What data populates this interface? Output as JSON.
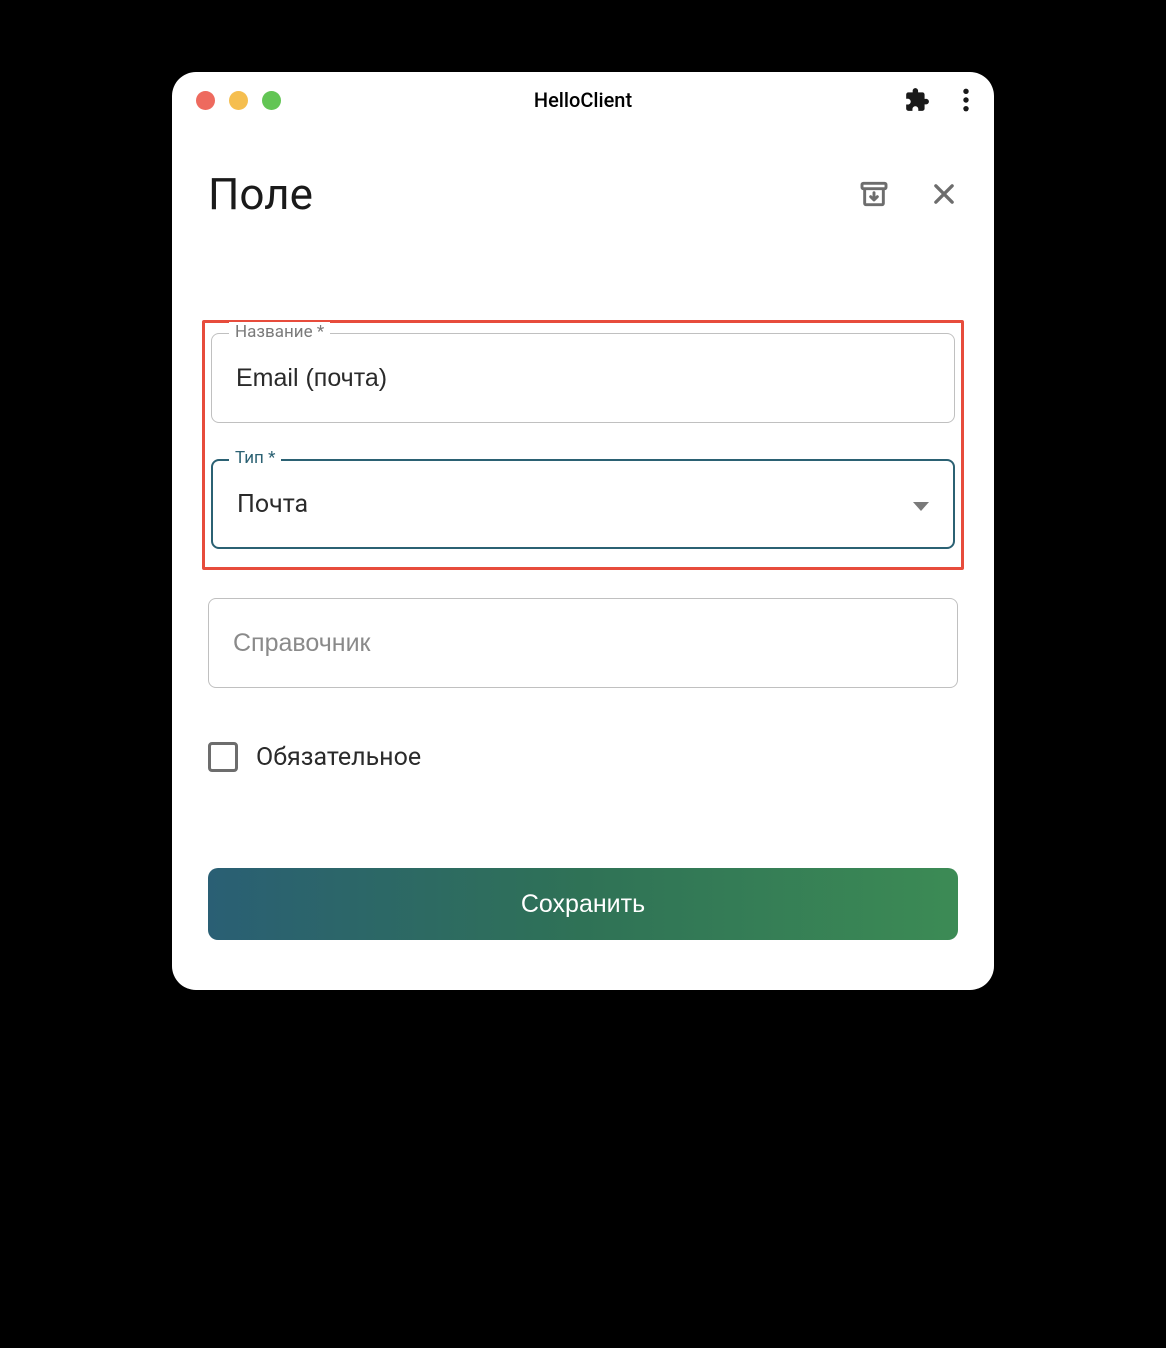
{
  "window": {
    "title": "HelloClient"
  },
  "page": {
    "title": "Поле"
  },
  "form": {
    "name_label": "Название *",
    "name_value": "Email (почта)",
    "type_label": "Тип *",
    "type_value": "Почта",
    "reference_placeholder": "Справочник",
    "reference_value": "",
    "required_label": "Обязательное",
    "required_checked": false,
    "save_label": "Сохранить"
  }
}
